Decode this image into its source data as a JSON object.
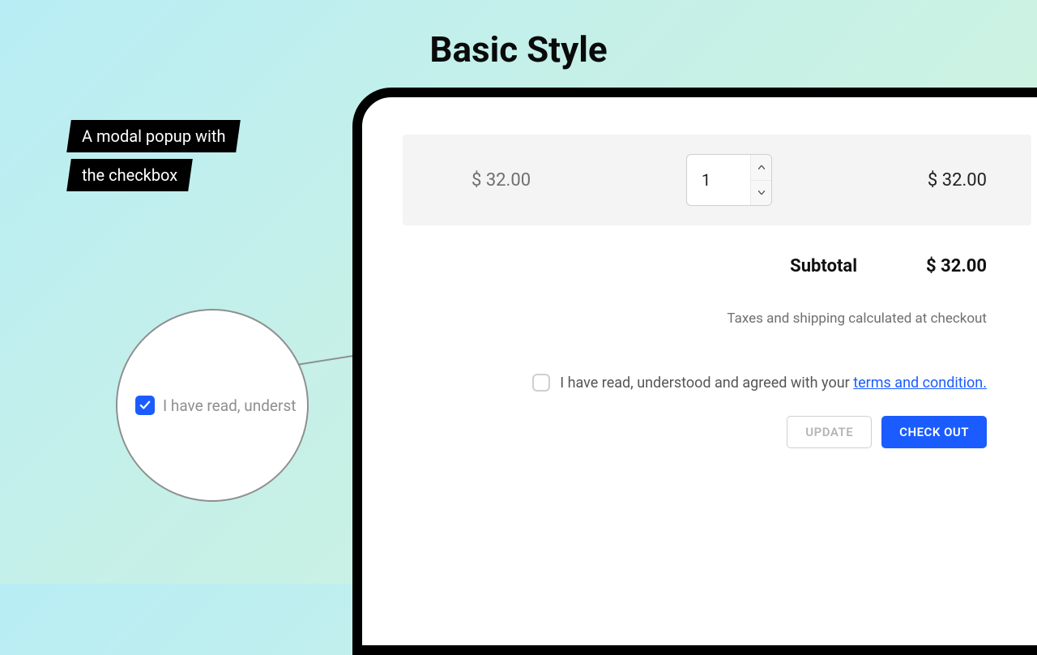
{
  "title": "Basic Style",
  "annotation": {
    "line1": "A modal popup with",
    "line2": "the checkbox"
  },
  "cart": {
    "unit_price": "$ 32.00",
    "quantity": "1",
    "line_total": "$ 32.00"
  },
  "subtotal": {
    "label": "Subtotal",
    "value": "$ 32.00"
  },
  "tax_note": "Taxes and shipping calculated at checkout",
  "terms": {
    "prefix": "I have read, understood and agreed with your ",
    "link_text": "terms and condition."
  },
  "buttons": {
    "update": "UPDATE",
    "checkout": "CHECK OUT"
  },
  "zoom": {
    "text": "I have read, underst"
  },
  "colors": {
    "accent": "#1a5cff"
  }
}
